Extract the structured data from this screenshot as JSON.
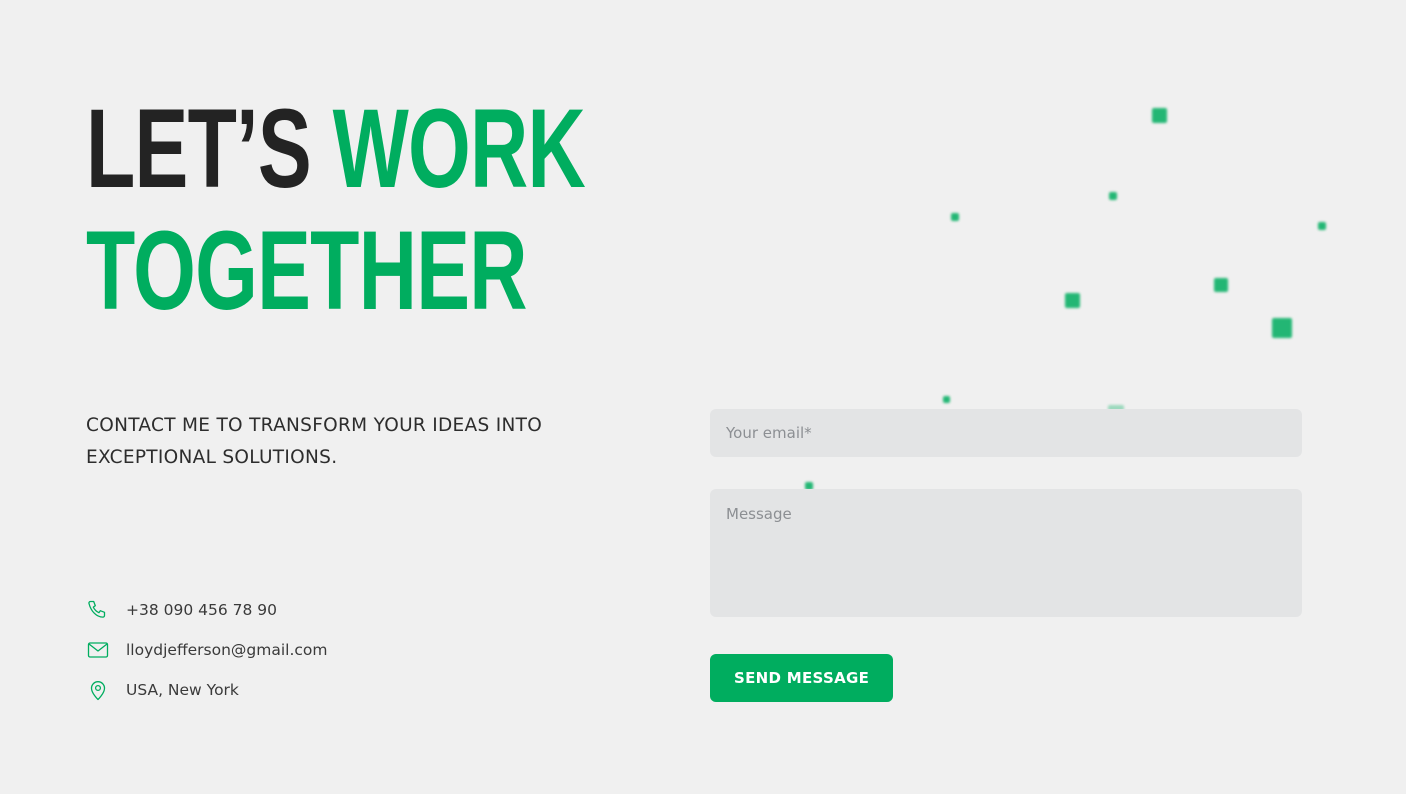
{
  "heading": {
    "part1": "LET’S",
    "part2": "WORK",
    "part3": "TOGETHER"
  },
  "subtitle": "CONTACT ME TO TRANSFORM YOUR IDEAS INTO EXCEPTIONAL SOLUTIONS.",
  "contacts": [
    {
      "icon": "phone-icon",
      "text": "+38 090 456 78 90"
    },
    {
      "icon": "mail-icon",
      "text": "lloydjefferson@gmail.com"
    },
    {
      "icon": "location-pin-icon",
      "text": "USA, New York"
    }
  ],
  "form": {
    "email_placeholder": "Your email*",
    "email_value": "",
    "message_placeholder": "Message",
    "message_value": "",
    "submit_label": "SEND MESSAGE"
  },
  "colors": {
    "accent": "#00ad5f",
    "background": "#f0f0f0",
    "field_background": "#e3e4e5",
    "heading_dark": "#232323"
  }
}
